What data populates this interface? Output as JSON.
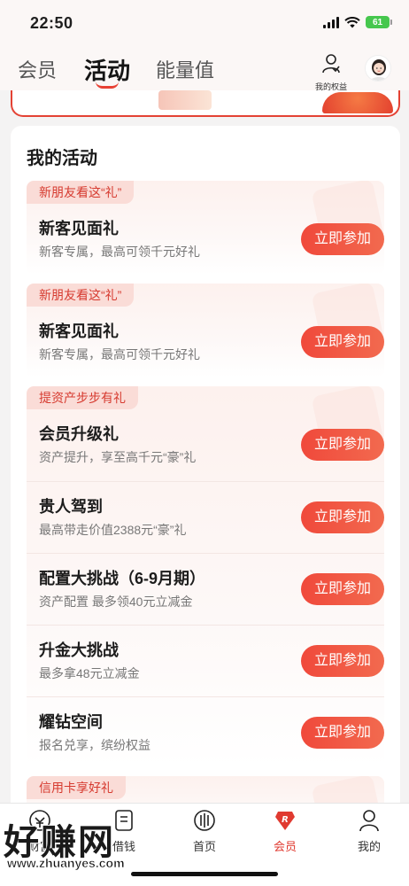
{
  "status_bar": {
    "time": "22:50",
    "battery": "61"
  },
  "header": {
    "tabs": [
      {
        "label": "会员"
      },
      {
        "label": "活动"
      },
      {
        "label": "能量值"
      }
    ],
    "rights_label": "我的权益"
  },
  "card": {
    "title": "我的活动",
    "groups": [
      {
        "tag": "新朋友看这“礼”",
        "rows": [
          {
            "title": "新客见面礼",
            "subtitle": "新客专属，最高可领千元好礼",
            "button": "立即参加"
          }
        ]
      },
      {
        "tag": "新朋友看这“礼”",
        "rows": [
          {
            "title": "新客见面礼",
            "subtitle": "新客专属，最高可领千元好礼",
            "button": "立即参加"
          }
        ]
      },
      {
        "tag": "提资产步步有礼",
        "rows": [
          {
            "title": "会员升级礼",
            "subtitle": "资产提升，享至高千元“豪”礼",
            "button": "立即参加"
          },
          {
            "title": "贵人驾到",
            "subtitle": "最高带走价值2388元“豪”礼",
            "button": "立即参加"
          },
          {
            "title": "配置大挑战（6-9月期）",
            "subtitle": "资产配置 最多领40元立减金",
            "button": "立即参加"
          },
          {
            "title": "升金大挑战",
            "subtitle": "最多拿48元立减金",
            "button": "立即参加"
          },
          {
            "title": "耀钻空间",
            "subtitle": "报名兑享，缤纷权益",
            "button": "立即参加"
          }
        ]
      },
      {
        "tag": "信用卡享好礼",
        "rows": []
      }
    ]
  },
  "bottom_nav": [
    {
      "label": "财富",
      "icon": "wealth-icon"
    },
    {
      "label": "借钱",
      "icon": "borrow-icon"
    },
    {
      "label": "首页",
      "icon": "home-icon"
    },
    {
      "label": "会员",
      "icon": "member-icon"
    },
    {
      "label": "我的",
      "icon": "profile-icon"
    }
  ],
  "watermark": {
    "text": "好赚网",
    "url": "www.zhuanyes.com"
  },
  "colors": {
    "accent": "#e84033",
    "tag_bg": "#fadcd7",
    "tag_text": "#d63a2f"
  }
}
